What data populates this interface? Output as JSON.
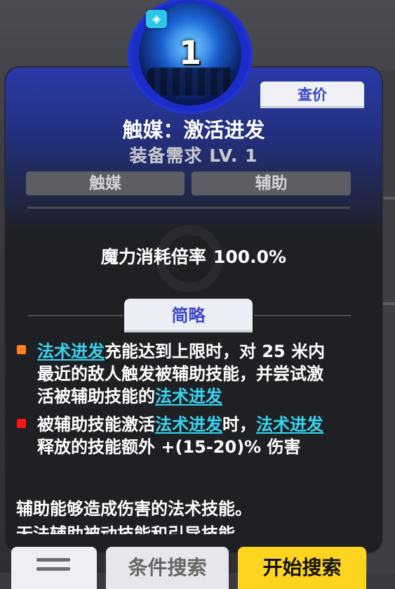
{
  "item": {
    "level_badge": "1",
    "title": "触媒：激活进发",
    "requirement": "装备需求  LV. 1",
    "price_button": "查价",
    "tags": [
      "触媒",
      "辅助"
    ],
    "stat_label": "魔力消耗倍率",
    "stat_value": "100.0%",
    "brief_button": "简略"
  },
  "effects": [
    {
      "bullet_color": "#ff7f1e",
      "parts": [
        {
          "t": "法术进发",
          "kw": true
        },
        {
          "t": "充能达到上限时，对 25 米内最近的敌人触发被辅助技能，并尝试激活被辅助技能的",
          "kw": false
        },
        {
          "t": "法术进发",
          "kw": true
        }
      ]
    },
    {
      "bullet_color": "#ff1414",
      "parts": [
        {
          "t": "被辅助技能激活",
          "kw": false
        },
        {
          "t": "法术进发",
          "kw": true
        },
        {
          "t": "时，",
          "kw": false
        },
        {
          "t": "法术进发",
          "kw": true
        },
        {
          "t": "释放的技能额外 +(15-20)% 伤害",
          "kw": false
        }
      ]
    }
  ],
  "footer": {
    "line1": "辅助能够造成伤害的法术技能。",
    "line2": "无法辅助被动技能和引导技能。"
  },
  "bottom_buttons": {
    "condition": "条件搜索",
    "search": "开始搜索"
  },
  "colors": {
    "accent_blue": "#3b47c4",
    "keyword": "#37d5f0",
    "search_yellow": "#ffd41f"
  }
}
